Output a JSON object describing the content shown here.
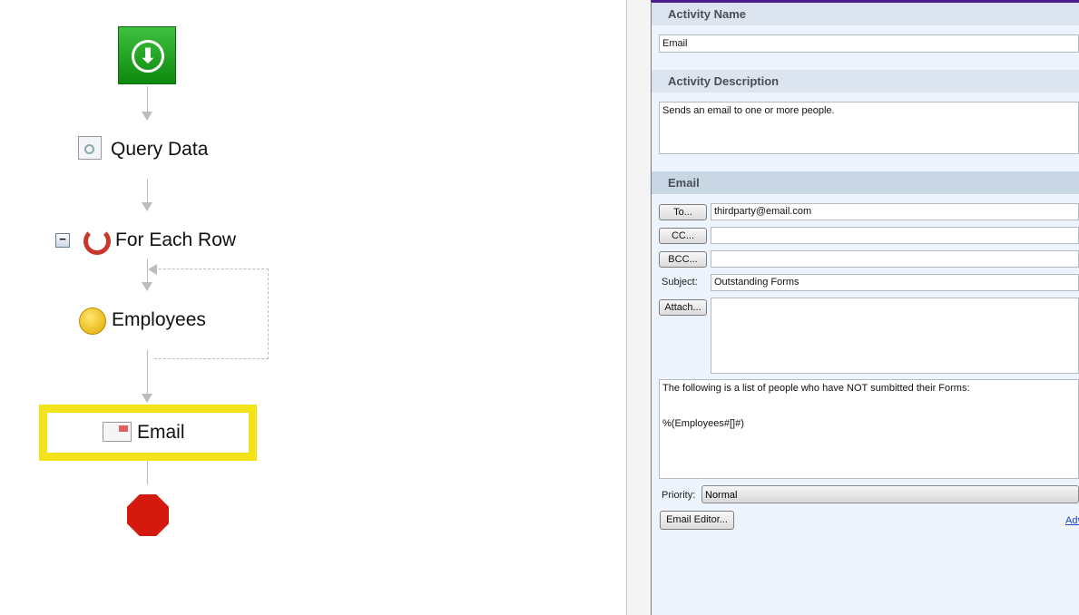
{
  "workflow": {
    "nodes": [
      {
        "label": "Query Data",
        "icon": "query-icon"
      },
      {
        "label": "For Each Row",
        "icon": "loop-icon"
      },
      {
        "label": "Employees",
        "icon": "coin-icon"
      },
      {
        "label": "Email",
        "icon": "envelope-icon"
      }
    ],
    "collapse_symbol": "−",
    "selected_color": "#f2e31a"
  },
  "properties": {
    "activity_name_header": "Activity Name",
    "activity_name_value": "Email",
    "activity_description_header": "Activity Description",
    "activity_description_value": "Sends an email to one or more people.",
    "email_header": "Email",
    "to_button": "To...",
    "to_value": "thirdparty@email.com",
    "cc_button": "CC...",
    "cc_value": "",
    "bcc_button": "BCC...",
    "bcc_value": "",
    "subject_label": "Subject:",
    "subject_value": "Outstanding Forms",
    "attach_button": "Attach...",
    "attach_value": "",
    "body_value": "The following is a list of people who have NOT sumbitted their Forms:\n\n\n%(Employees#[]#)",
    "priority_label": "Priority:",
    "priority_value": "Normal",
    "email_editor_button": "Email Editor...",
    "advanced_link": "Adv"
  }
}
